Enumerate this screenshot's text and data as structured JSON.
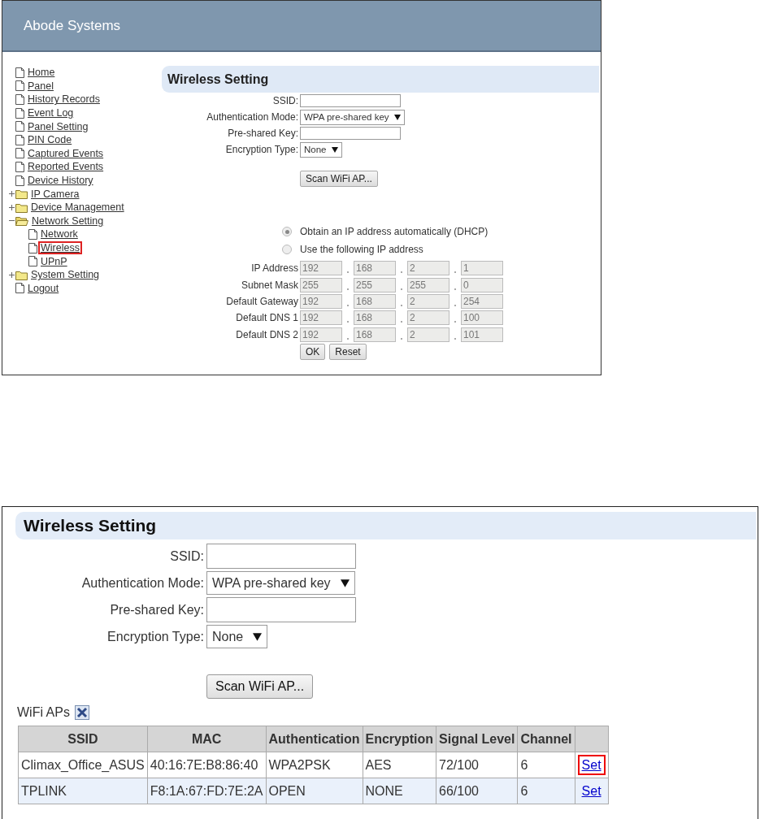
{
  "top": {
    "header": {
      "title": "Abode Systems"
    },
    "sidebar": {
      "items": [
        {
          "label": "Home",
          "kind": "page",
          "highlighted": false
        },
        {
          "label": "Panel",
          "kind": "page",
          "highlighted": false
        },
        {
          "label": "History Records",
          "kind": "page",
          "highlighted": false
        },
        {
          "label": "Event Log",
          "kind": "page",
          "highlighted": false
        },
        {
          "label": "Panel Setting",
          "kind": "page",
          "highlighted": false
        },
        {
          "label": "PIN Code",
          "kind": "page",
          "highlighted": false
        },
        {
          "label": "Captured Events",
          "kind": "page",
          "highlighted": false
        },
        {
          "label": "Reported Events",
          "kind": "page",
          "highlighted": false
        },
        {
          "label": "Device History",
          "kind": "page",
          "highlighted": false
        },
        {
          "label": "IP Camera",
          "kind": "folder",
          "expanded": false,
          "highlighted": false
        },
        {
          "label": "Device Management",
          "kind": "folder",
          "expanded": false,
          "highlighted": false
        },
        {
          "label": "Network Setting",
          "kind": "folder",
          "expanded": true,
          "highlighted": false,
          "children": [
            {
              "label": "Network",
              "kind": "page",
              "highlighted": false
            },
            {
              "label": "Wireless",
              "kind": "page",
              "highlighted": true
            },
            {
              "label": "UPnP",
              "kind": "page",
              "highlighted": false
            }
          ]
        },
        {
          "label": "System Setting",
          "kind": "folder",
          "expanded": false,
          "highlighted": false
        },
        {
          "label": "Logout",
          "kind": "page",
          "highlighted": false
        }
      ]
    },
    "form": {
      "title": "Wireless Setting",
      "fields": [
        {
          "kind": "text",
          "label": "SSID:"
        },
        {
          "kind": "select",
          "label": "Authentication Mode:",
          "value": "WPA pre-shared key"
        },
        {
          "kind": "text",
          "label": "Pre-shared Key:"
        },
        {
          "kind": "select",
          "label": "Encryption Type:",
          "value": "None"
        }
      ],
      "scan_button": "Scan WiFi AP...",
      "ip_mode": [
        {
          "label": "Obtain an IP address automatically (DHCP)",
          "selected": true
        },
        {
          "label": "Use the following IP address",
          "selected": false
        }
      ],
      "addresses": [
        {
          "label": "IP Address",
          "disabled": true,
          "octets": [
            "192",
            "168",
            "2",
            "1"
          ]
        },
        {
          "label": "Subnet Mask",
          "disabled": true,
          "octets": [
            "255",
            "255",
            "255",
            "0"
          ]
        },
        {
          "label": "Default Gateway",
          "disabled": true,
          "octets": [
            "192",
            "168",
            "2",
            "254"
          ]
        },
        {
          "label": "Default DNS 1",
          "disabled": true,
          "octets": [
            "192",
            "168",
            "2",
            "100"
          ]
        },
        {
          "label": "Default DNS 2",
          "disabled": true,
          "octets": [
            "192",
            "168",
            "2",
            "101"
          ]
        }
      ],
      "buttons": [
        "OK",
        "Reset"
      ]
    }
  },
  "bottom": {
    "title": "Wireless Setting",
    "fields": [
      {
        "kind": "text",
        "label": "SSID:"
      },
      {
        "kind": "select",
        "label": "Authentication Mode:",
        "value": "WPA pre-shared key"
      },
      {
        "kind": "text",
        "label": "Pre-shared Key:"
      },
      {
        "kind": "select",
        "label": "Encryption Type:",
        "value": "None"
      }
    ],
    "scan_button": "Scan WiFi AP...",
    "ap_list": {
      "label": "WiFi APs",
      "columns": [
        "SSID",
        "MAC",
        "Authentication",
        "Encryption",
        "Signal Level",
        "Channel"
      ],
      "rows": [
        {
          "cells": [
            "Climax_Office_ASUS",
            "40:16:7E:B8:86:40",
            "WPA2PSK",
            "AES",
            "72/100",
            "6"
          ],
          "action": "Set",
          "highlighted": true
        },
        {
          "cells": [
            "TPLINK",
            "F8:1A:67:FD:7E:2A",
            "OPEN",
            "NONE",
            "66/100",
            "6"
          ],
          "action": "Set",
          "highlighted": false
        }
      ]
    }
  }
}
